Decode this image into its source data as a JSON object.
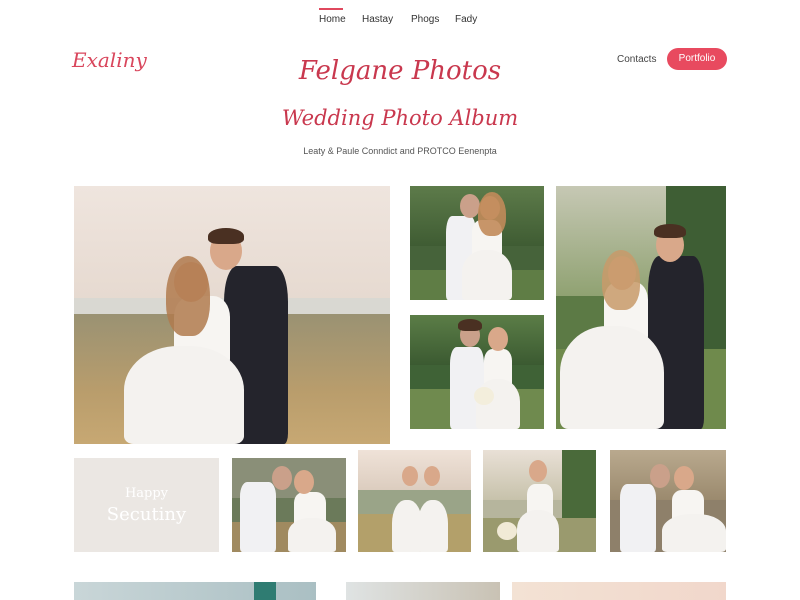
{
  "nav": {
    "items": [
      "Home",
      "Hastay",
      "Phogs",
      "Fady"
    ]
  },
  "header": {
    "brand": "Exaliny",
    "contacts": "Contacts",
    "cta": "Portfolio"
  },
  "hero": {
    "title": "Felgane Photos",
    "subtitle": "Wedding Photo Album",
    "description": "Leaty & Paule Conndict and PROTCO Eenenpta"
  },
  "caption_tile": {
    "line1": "Happy",
    "line2": "Secutiny"
  },
  "colors": {
    "accent": "#e84a5f",
    "title": "#c9384e",
    "tile_bg": "#ebe7e3"
  }
}
